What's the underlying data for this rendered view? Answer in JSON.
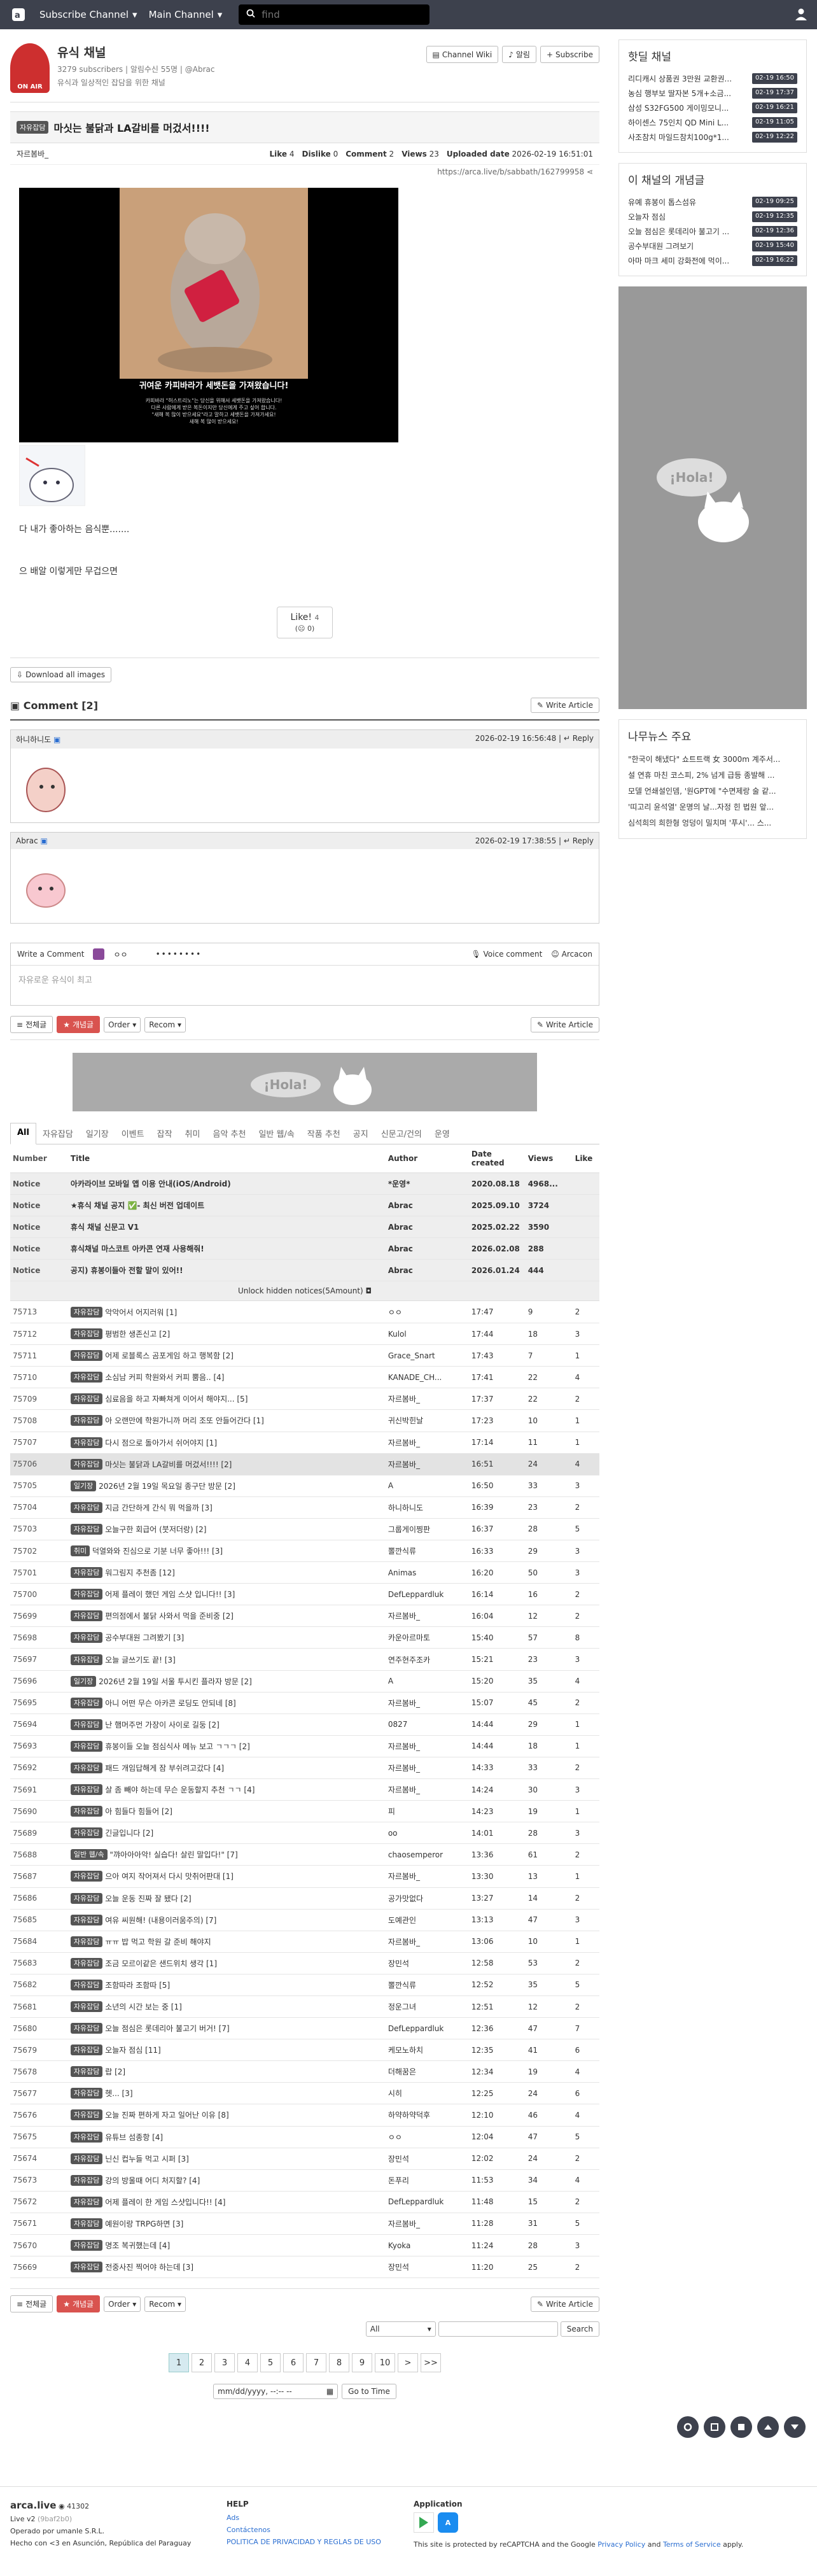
{
  "nav": {
    "subscribe_channel": "Subscribe Channel",
    "main_channel": "Main Channel",
    "search_placeholder": "find"
  },
  "board": {
    "title": "유식 채널",
    "subscribers": "3279 subscribers",
    "alarm": "알림수신 55명",
    "admin": "@Abrac",
    "desc": "유식과 일상적인 잡담을 위한 채널",
    "logo_text": "ON AIR",
    "btn_wiki": "Channel Wiki",
    "btn_alarm": "알림",
    "btn_subscribe": "Subscribe"
  },
  "article": {
    "tag": "자유잡담",
    "title": "마싯는 불닭과 LA갈비를 머겄서!!!!",
    "author": "자르봄바_",
    "like_label": "Like",
    "like": "4",
    "dislike_label": "Dislike",
    "dislike": "0",
    "comment_label": "Comment",
    "comment": "2",
    "views_label": "Views",
    "views": "23",
    "uploaded_label": "Uploaded date",
    "uploaded": "2026-02-19 16:51:01",
    "url": "https://arca.live/b/sabbath/162799958",
    "fig_caption": "귀여운 카피바라가 세뱃돈을 가져왔습니다!",
    "fig_text1": "카피바라 \"허스트리노\"는 당신을 위해서 세뱃돈을 가져왔습니다!",
    "fig_text2": "다른 사람에게 받은 복돈이지만 당신에게 주고 싶어 합니다.",
    "fig_text3": "\"새해 복 많이 받으세요\"라고 말하고 세뱃돈을 가져가세요!",
    "fig_text4": "새해 복 많이 받으세요!",
    "body1": "다 내가 좋아하는 음식뿐.......",
    "body2": "으 배알 이렇게만 무겁으면",
    "vote_label": "Like!",
    "vote_count": "4",
    "vote_dis": "0",
    "download": "Download all images"
  },
  "comments": {
    "title": "Comment [2]",
    "write": "Write Article",
    "items": [
      {
        "author": "하니하니도",
        "date": "2026-02-19 16:56:48",
        "reply": "Reply"
      },
      {
        "author": "Abrac",
        "date": "2026-02-19 17:38:55",
        "reply": "Reply"
      }
    ],
    "write_comment": "Write a Comment",
    "voice": "Voice comment",
    "arcacon": "Arcacon",
    "placeholder": "자유로운 유식이 최고"
  },
  "filters": {
    "all": "전체글",
    "best": "개념글",
    "order": "Order",
    "recom": "Recom",
    "write": "Write Article"
  },
  "ad_text": "¡Hola!",
  "tabs": [
    "All",
    "자유잡담",
    "일기장",
    "이벤트",
    "잡작",
    "취미",
    "음악 추천",
    "일반 웹/속",
    "작품 추천",
    "공지",
    "신문고/건의",
    "운영"
  ],
  "table": {
    "headers": [
      "Number",
      "Title",
      "Author",
      "Date created",
      "Views",
      "Like"
    ],
    "notices": [
      {
        "num": "Notice",
        "title": "아카라이브 모바일 앱 이용 안내(iOS/Android)",
        "author": "*운영*",
        "date": "2020.08.18",
        "views": "4968...",
        "like": ""
      },
      {
        "num": "Notice",
        "title": "★휴식 채널 공지 ✅- 최신 버전 업데이트",
        "author": "Abrac",
        "date": "2025.09.10",
        "views": "3724",
        "like": ""
      },
      {
        "num": "Notice",
        "title": "휴식 채널 신문고 V1",
        "author": "Abrac",
        "date": "2025.02.22",
        "views": "3590",
        "like": ""
      },
      {
        "num": "Notice",
        "title": "휴식채널 마스코트 아카콘 연재 사용해줘!",
        "author": "Abrac",
        "date": "2026.02.08",
        "views": "288",
        "like": ""
      },
      {
        "num": "Notice",
        "title": "공지) 휴봉이들아 전할 말이 있어!!",
        "author": "Abrac",
        "date": "2026.01.24",
        "views": "444",
        "like": ""
      }
    ],
    "unlock": "Unlock hidden notices(5Amount)",
    "rows": [
      {
        "num": "75713",
        "tag": "자유잡담",
        "title": "악악어서 어지러워 [1]",
        "author": "ㅇㅇ",
        "date": "17:47",
        "views": "9",
        "like": "2"
      },
      {
        "num": "75712",
        "tag": "자유잡담",
        "title": "평범한 생존신고 [2]",
        "author": "Kulol",
        "date": "17:44",
        "views": "18",
        "like": "3"
      },
      {
        "num": "75711",
        "tag": "자유잡담",
        "title": "어제 로블록스 곰포게임 하고 행복함 [2]",
        "author": "Grace_Snart",
        "date": "17:43",
        "views": "7",
        "like": "1"
      },
      {
        "num": "75710",
        "tag": "자유잡담",
        "title": "소심남 커피 학원와서 커피 뿜음.. [4]",
        "author": "KANADE_CH...",
        "date": "17:41",
        "views": "22",
        "like": "4"
      },
      {
        "num": "75709",
        "tag": "자유잡담",
        "title": "심료음을 하고 자빠쳐게 이어서 해야지... [5]",
        "author": "자르봄바_",
        "date": "17:37",
        "views": "22",
        "like": "2"
      },
      {
        "num": "75708",
        "tag": "자유잡담",
        "title": "아 오랜만에 학원가니까 머리 조또 안들어간다 [1]",
        "author": "귀신박힌날",
        "date": "17:23",
        "views": "10",
        "like": "1"
      },
      {
        "num": "75707",
        "tag": "자유잡담",
        "title": "다시 점으로 돌아가서 쉬어야지 [1]",
        "author": "자르봄바_",
        "date": "17:14",
        "views": "11",
        "like": "1"
      },
      {
        "num": "75706",
        "tag": "자유잡담",
        "title": "마싯는 불닭과 LA갈비를 머겄서!!!! [2]",
        "author": "자르봄바_",
        "date": "16:51",
        "views": "24",
        "like": "4",
        "current": true
      },
      {
        "num": "75705",
        "tag": "일기장",
        "title": "2026년 2월 19일 목요일 종구단 방문 [2]",
        "author": "A",
        "date": "16:50",
        "views": "33",
        "like": "3"
      },
      {
        "num": "75704",
        "tag": "자유잡담",
        "title": "지금 간단하게 간식 뭐 먹을까 [3]",
        "author": "하니하니도",
        "date": "16:39",
        "views": "23",
        "like": "2"
      },
      {
        "num": "75703",
        "tag": "자유잡담",
        "title": "오늘구한 회급어 (붓저더랑) [2]",
        "author": "그룹게이찡판",
        "date": "16:37",
        "views": "28",
        "like": "5"
      },
      {
        "num": "75702",
        "tag": "취미",
        "title": "덕열와와 진심으로 기분 너무 좋아!!! [3]",
        "author": "뽈깐식류",
        "date": "16:33",
        "views": "29",
        "like": "3"
      },
      {
        "num": "75701",
        "tag": "자유잡담",
        "title": "워그림지 추천좀 [12]",
        "author": "Animas",
        "date": "16:20",
        "views": "50",
        "like": "3"
      },
      {
        "num": "75700",
        "tag": "자유잡담",
        "title": "어제 플레이 했던 게임 스샷 입니다!! [3]",
        "author": "DefLeppardluk",
        "date": "16:14",
        "views": "16",
        "like": "2"
      },
      {
        "num": "75699",
        "tag": "자유잡담",
        "title": "편의점에서 불닭 사와서 먹을 준비중 [2]",
        "author": "자르봄바_",
        "date": "16:04",
        "views": "12",
        "like": "2"
      },
      {
        "num": "75698",
        "tag": "자유잡담",
        "title": "공수부대원 그려봤기 [3]",
        "author": "카운아르마토",
        "date": "15:40",
        "views": "57",
        "like": "8"
      },
      {
        "num": "75697",
        "tag": "자유잡담",
        "title": "오늘 글쓰기도 끝! [3]",
        "author": "연주현주조카",
        "date": "15:21",
        "views": "23",
        "like": "3"
      },
      {
        "num": "75696",
        "tag": "일기장",
        "title": "2026년 2월 19일 서울 투시킨 플라자 방문 [2]",
        "author": "A",
        "date": "15:20",
        "views": "35",
        "like": "4"
      },
      {
        "num": "75695",
        "tag": "자유잡담",
        "title": "아니 어떤 무슨 아카콘 로딩도 안되네 [8]",
        "author": "자르봄바_",
        "date": "15:07",
        "views": "45",
        "like": "2"
      },
      {
        "num": "75694",
        "tag": "자유잡담",
        "title": "난 햄머주먼 가장이 사이로 길둥 [2]",
        "author": "0827",
        "date": "14:44",
        "views": "29",
        "like": "1"
      },
      {
        "num": "75693",
        "tag": "자유잡담",
        "title": "휴봉이들 오늘 점심식사 메뉴 보고 ㄱㄱㄱ [2]",
        "author": "자르봄바_",
        "date": "14:44",
        "views": "18",
        "like": "1"
      },
      {
        "num": "75692",
        "tag": "자유잡담",
        "title": "패드 개임답해게 잠 부쉬려고갔다 [4]",
        "author": "자르봄바_",
        "date": "14:33",
        "views": "33",
        "like": "2"
      },
      {
        "num": "75691",
        "tag": "자유잡담",
        "title": "살 좀 빼야 하는데 무슨 운동할지 추천 ㄱㄱ [4]",
        "author": "자르봄바_",
        "date": "14:24",
        "views": "30",
        "like": "3"
      },
      {
        "num": "75690",
        "tag": "자유잡담",
        "title": "아 힘들다 힘들어 [2]",
        "author": "피",
        "date": "14:23",
        "views": "19",
        "like": "1"
      },
      {
        "num": "75689",
        "tag": "자유잡담",
        "title": "긴글입니다 [2]",
        "author": "oo",
        "date": "14:01",
        "views": "28",
        "like": "3"
      },
      {
        "num": "75688",
        "tag": "일반 웹/속",
        "title": "\"꺄아아아악! 실습다! 살린 말입다!\" [7]",
        "author": "chaosemperor",
        "date": "13:36",
        "views": "61",
        "like": "2"
      },
      {
        "num": "75687",
        "tag": "자유잡담",
        "title": "으아 여지 작어져서 다시 맛취어판대 [1]",
        "author": "자르봄바_",
        "date": "13:30",
        "views": "13",
        "like": "1"
      },
      {
        "num": "75686",
        "tag": "자유잡담",
        "title": "오늘 운동 진짜 잘 됐다 [2]",
        "author": "공가맛없다",
        "date": "13:27",
        "views": "14",
        "like": "2"
      },
      {
        "num": "75685",
        "tag": "자유잡담",
        "title": "여유 씨원해! (내용이러움주의) [7]",
        "author": "도예관인",
        "date": "13:13",
        "views": "47",
        "like": "3"
      },
      {
        "num": "75684",
        "tag": "자유잡담",
        "title": "ㅠㅠ 밥 먹고 학원 갈 준비 해야지",
        "author": "자르봄바_",
        "date": "13:06",
        "views": "10",
        "like": "1"
      },
      {
        "num": "75683",
        "tag": "자유잡담",
        "title": "조금 모르이같은 샌드위치 생각 [1]",
        "author": "장민석",
        "date": "12:58",
        "views": "53",
        "like": "2"
      },
      {
        "num": "75682",
        "tag": "자유잡담",
        "title": "조함따라 조함따 [5]",
        "author": "뽈깐식류",
        "date": "12:52",
        "views": "35",
        "like": "5"
      },
      {
        "num": "75681",
        "tag": "자유잡담",
        "title": "소년의 시간 보는 중 [1]",
        "author": "정운그녀",
        "date": "12:51",
        "views": "12",
        "like": "2"
      },
      {
        "num": "75680",
        "tag": "자유잡담",
        "title": "오늘 점심은 롯데리아 불고기 버거! [7]",
        "author": "DefLeppardluk",
        "date": "12:36",
        "views": "47",
        "like": "7"
      },
      {
        "num": "75679",
        "tag": "자유잡담",
        "title": "오늘자 점심 [11]",
        "author": "케모노하치",
        "date": "12:35",
        "views": "41",
        "like": "6"
      },
      {
        "num": "75678",
        "tag": "자유잡담",
        "title": "랍 [2]",
        "author": "더해꿈은",
        "date": "12:34",
        "views": "19",
        "like": "4"
      },
      {
        "num": "75677",
        "tag": "자유잡담",
        "title": "헷... [3]",
        "author": "시히",
        "date": "12:25",
        "views": "24",
        "like": "6"
      },
      {
        "num": "75676",
        "tag": "자유잡담",
        "title": "오늘 진짜 편하게 자고 일어난 이유 [8]",
        "author": "하약하약덕후",
        "date": "12:10",
        "views": "46",
        "like": "4"
      },
      {
        "num": "75675",
        "tag": "자유잡담",
        "title": "유튜브 섬종항 [4]",
        "author": "ㅇㅇ",
        "date": "12:04",
        "views": "47",
        "like": "5"
      },
      {
        "num": "75674",
        "tag": "자유잡담",
        "title": "닌신 컵누들 먹고 시퍼 [3]",
        "author": "장민석",
        "date": "12:02",
        "views": "24",
        "like": "2"
      },
      {
        "num": "75673",
        "tag": "자유잡담",
        "title": "강의 방울때 어디 처지할? [4]",
        "author": "돈푸리",
        "date": "11:53",
        "views": "34",
        "like": "4"
      },
      {
        "num": "75672",
        "tag": "자유잡담",
        "title": "어제 플레이 한 게임 스샷입니다!! [4]",
        "author": "DefLeppardluk",
        "date": "11:48",
        "views": "15",
        "like": "2"
      },
      {
        "num": "75671",
        "tag": "자유잡담",
        "title": "예원이랑 TRPG하면 [3]",
        "author": "자르봄바_",
        "date": "11:28",
        "views": "31",
        "like": "5"
      },
      {
        "num": "75670",
        "tag": "자유잡담",
        "title": "명조 복귀했는데 [4]",
        "author": "Kyoka",
        "date": "11:24",
        "views": "28",
        "like": "3"
      },
      {
        "num": "75669",
        "tag": "자유잡담",
        "title": "전중사진 찍어야 하는데 [3]",
        "author": "장민석",
        "date": "11:20",
        "views": "25",
        "like": "2"
      }
    ]
  },
  "pagination": {
    "pages": [
      "1",
      "2",
      "3",
      "4",
      "5",
      "6",
      "7",
      "8",
      "9",
      "10"
    ],
    "search_all": "All",
    "search_btn": "Search",
    "date_placeholder": "mm/dd/yyyy, --:-- --",
    "goto": "Go to Time"
  },
  "sidebar": {
    "hot_title": "핫딜 채널",
    "hot": [
      {
        "t": "리디캐시 상품권 3만원 교환권...",
        "time": "02-19 16:50"
      },
      {
        "t": "농심 행부보 딸자본 5개+소금...",
        "time": "02-19 17:37"
      },
      {
        "t": "삼성 S32FG500 게이밍모니...",
        "time": "02-19 16:21"
      },
      {
        "t": "하이센스 75인치 QD Mini L...",
        "time": "02-19 11:05"
      },
      {
        "t": "사조참치 마일드참치100g*1...",
        "time": "02-19 12:22"
      }
    ],
    "best_title": "이 채널의 개념글",
    "best": [
      {
        "t": "유예 휴봉이 톱스섬유",
        "time": "02-19 09:25"
      },
      {
        "t": "오늘자 점심",
        "time": "02-19 12:35"
      },
      {
        "t": "오늘 점심은 롯데리아 불고기 ...",
        "time": "02-19 12:36"
      },
      {
        "t": "공수부대원 그려보기",
        "time": "02-19 15:40"
      },
      {
        "t": "아마 마크 세미 강화전에 먹이...",
        "time": "02-19 16:22"
      }
    ],
    "ad_text": "¡Hola!",
    "news_title": "나무뉴스 주요",
    "news": [
      "\"한국이 해냈다\" 쇼트트랙 女 3000m 계주서...",
      "설 연휴 마친 코스피, 2% 넘게 급등 종발해 ...",
      "모델 언쇄설인뎀, '원GPT에 \"수면제랑 술 같...",
      "'띠고리 윤석열' 운명의 날...자정 힌 법원 앞...",
      "심석희의 희한형 엉덩이 밀치며 '푸시'... 스..."
    ]
  },
  "footer": {
    "brand": "arca.live",
    "visits": "41302",
    "version": "Live v2",
    "build": "(9baf2b0)",
    "op": "Operado por umanle S.R.L.",
    "made": "Hecho con <3 en Asunción, República del Paraguay",
    "help": "HELP",
    "ads": "Ads",
    "contact": "Contáctenos",
    "policy": "POLITICA DE PRIVACIDAD Y REGLAS DE USO",
    "app": "Application",
    "recaptcha": "This site is protected by reCAPTCHA and the Google",
    "privacy": "Privacy Policy",
    "and": "and",
    "terms": "Terms of Service",
    "apply": "apply."
  },
  "colors": {
    "nav": "#3d414d",
    "tag": "#555555",
    "best": "#d9534f",
    "notice": "#eeeeee"
  }
}
